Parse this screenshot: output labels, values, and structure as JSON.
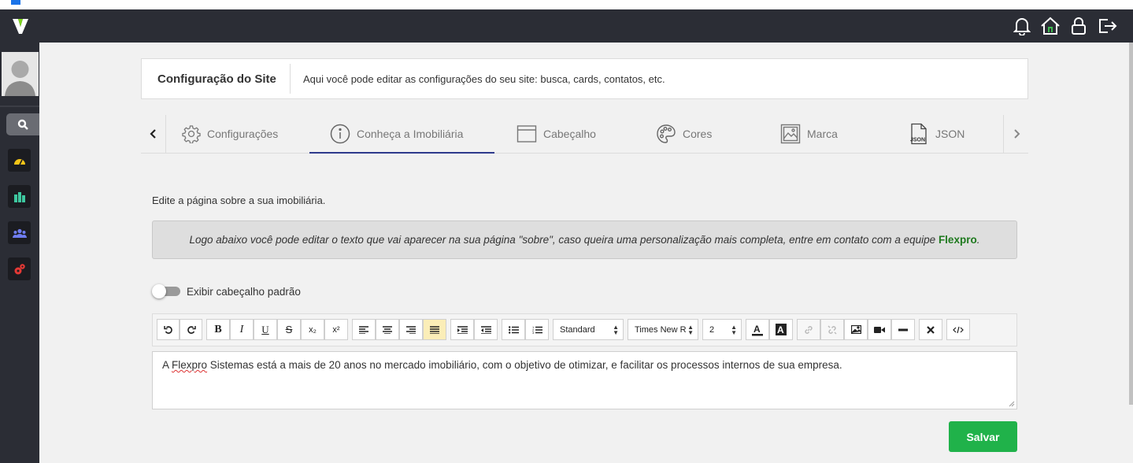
{
  "colors": {
    "topbar": "#2b2d35",
    "accent": "#2e3a8c",
    "brand_green": "#1f7a1f",
    "save": "#20b24a",
    "logo": "#7ed321"
  },
  "topbar": {
    "icons": [
      "bell-icon",
      "home-icon",
      "lock-icon",
      "logout-icon"
    ]
  },
  "sidebar": {
    "items": [
      "search-icon",
      "dashboard-icon",
      "buildings-icon",
      "users-icon",
      "settings-icon"
    ]
  },
  "header": {
    "title": "Configuração do Site",
    "description": "Aqui você pode editar as configurações do seu site: busca, cards, contatos, etc."
  },
  "tabs": [
    {
      "label": "Configurações",
      "icon": "gear-icon"
    },
    {
      "label": "Conheça a Imobiliária",
      "icon": "info-icon",
      "active": true
    },
    {
      "label": "Cabeçalho",
      "icon": "window-icon"
    },
    {
      "label": "Cores",
      "icon": "palette-icon"
    },
    {
      "label": "Marca",
      "icon": "image-icon"
    },
    {
      "label": "JSON",
      "icon": "json-file-icon"
    }
  ],
  "main": {
    "intro": "Edite a página sobre a sua imobiliária.",
    "notice_text": "Logo abaixo você pode editar o texto que vai aparecer na sua página \"sobre\", caso queira uma personalização mais completa, entre em contato com a equipe ",
    "notice_brand": "Flexpro",
    "notice_end": ".",
    "toggle_label": "Exibir cabeçalho padrão",
    "toggle_on": false
  },
  "toolbar": {
    "bold": "B",
    "italic": "I",
    "underline": "U",
    "strike": "S",
    "subscript": "x₂",
    "superscript": "x²",
    "format_value": "Standard",
    "font_value": "Times New R",
    "size_value": "2"
  },
  "editor": {
    "text_prefix": "A ",
    "text_misspelled": "Flexpro",
    "text_rest": " Sistemas está a mais de 20 anos no mercado imobiliário, com o objetivo de otimizar, e facilitar os processos internos de sua empresa."
  },
  "save_label": "Salvar"
}
